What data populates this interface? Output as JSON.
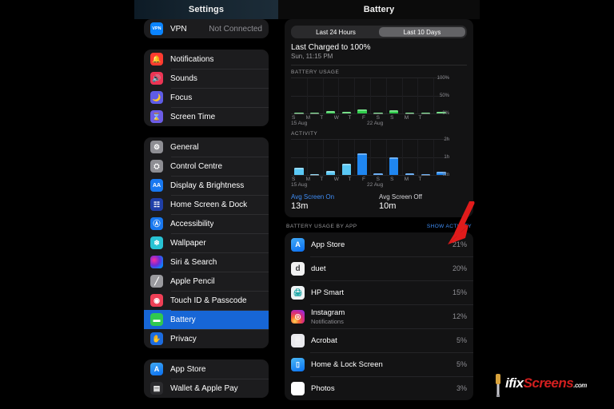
{
  "titles": {
    "sidebar": "Settings",
    "detail": "Battery"
  },
  "sidebar": {
    "groups": [
      {
        "items": [
          {
            "label": "VPN",
            "value": "Not Connected",
            "icon": "vpn-icon",
            "icon_text": "VPN"
          }
        ]
      },
      {
        "items": [
          {
            "label": "Notifications",
            "icon": "notifications-icon",
            "icon_text": "🔔"
          },
          {
            "label": "Sounds",
            "icon": "sounds-icon",
            "icon_text": "🔊"
          },
          {
            "label": "Focus",
            "icon": "focus-icon",
            "icon_text": "🌙"
          },
          {
            "label": "Screen Time",
            "icon": "screen-time-icon",
            "icon_text": "⌛"
          }
        ]
      },
      {
        "items": [
          {
            "label": "General",
            "icon": "general-gear-icon",
            "icon_text": "⚙"
          },
          {
            "label": "Control Centre",
            "icon": "control-centre-icon",
            "icon_text": "⛭"
          },
          {
            "label": "Display & Brightness",
            "icon": "display-brightness-icon",
            "icon_text": "AA"
          },
          {
            "label": "Home Screen & Dock",
            "icon": "home-screen-dock-icon",
            "icon_text": "☷"
          },
          {
            "label": "Accessibility",
            "icon": "accessibility-icon",
            "icon_text": "Ⓐ"
          },
          {
            "label": "Wallpaper",
            "icon": "wallpaper-icon",
            "icon_text": "❄"
          },
          {
            "label": "Siri & Search",
            "icon": "siri-search-icon",
            "icon_text": ""
          },
          {
            "label": "Apple Pencil",
            "icon": "apple-pencil-icon",
            "icon_text": "╱"
          },
          {
            "label": "Touch ID & Passcode",
            "icon": "touch-id-passcode-icon",
            "icon_text": "◉"
          },
          {
            "label": "Battery",
            "icon": "battery-icon",
            "icon_text": "▬",
            "selected": true
          },
          {
            "label": "Privacy",
            "icon": "privacy-hand-icon",
            "icon_text": "✋"
          }
        ]
      },
      {
        "items": [
          {
            "label": "App Store",
            "icon": "app-store-icon",
            "icon_text": "A"
          },
          {
            "label": "Wallet & Apple Pay",
            "icon": "wallet-apple-pay-icon",
            "icon_text": "▤"
          }
        ]
      }
    ]
  },
  "battery": {
    "segmented": {
      "options": [
        "Last 24 Hours",
        "Last 10 Days"
      ],
      "selected": "Last 10 Days"
    },
    "last_charged": "Last Charged to 100%",
    "last_charged_time": "Sun, 11:15 PM",
    "avg_screen_on_label": "Avg Screen On",
    "avg_screen_on_value": "13m",
    "avg_screen_off_label": "Avg Screen Off",
    "avg_screen_off_value": "10m",
    "by_app_title": "BATTERY USAGE BY APP",
    "show_activity": "SHOW ACTIVITY"
  },
  "chart_data": [
    {
      "type": "bar",
      "title": "BATTERY USAGE",
      "categories": [
        "S",
        "M",
        "T",
        "W",
        "T",
        "F",
        "S",
        "S",
        "M",
        "T"
      ],
      "values": [
        3,
        1,
        6,
        5,
        11,
        3,
        10,
        2,
        1,
        4
      ],
      "ylabel": "",
      "ytick_labels": [
        "100%",
        "50%",
        "0%"
      ],
      "ytick_values": [
        100,
        50,
        0
      ],
      "ylim": [
        0,
        100
      ],
      "date_labels": [
        {
          "text": "15 Aug",
          "index": 0
        },
        {
          "text": "22 Aug",
          "index": 7
        }
      ],
      "grid": true,
      "series_color": "#2ecc4a",
      "xlabel": ""
    },
    {
      "type": "bar",
      "title": "ACTIVITY",
      "categories": [
        "S",
        "M",
        "T",
        "W",
        "T",
        "F",
        "S",
        "S",
        "M",
        "T"
      ],
      "values": [
        0.42,
        0.05,
        0.22,
        0.62,
        1.22,
        0.07,
        1.02,
        0.07,
        0.04,
        0.2
      ],
      "bar_shades": [
        "light",
        "light",
        "light",
        "light",
        "dark",
        "dark",
        "dark",
        "dark",
        "dark",
        "dark"
      ],
      "ylabel": "",
      "ytick_labels": [
        "2h",
        "1h",
        "0m"
      ],
      "ytick_values": [
        2,
        1,
        0
      ],
      "ylim": [
        0,
        2
      ],
      "date_labels": [
        {
          "text": "15 Aug",
          "index": 0
        },
        {
          "text": "22 Aug",
          "index": 7
        }
      ],
      "grid": true,
      "series_color_light": "#5ac8f5",
      "series_color_dark": "#1f86f0",
      "xlabel": ""
    }
  ],
  "apps": [
    {
      "name": "App Store",
      "subtitle": "",
      "percent": "21%",
      "icon": "app-store-icon",
      "icon_text": "A",
      "icon_class": "ai-appstore"
    },
    {
      "name": "duet",
      "subtitle": "",
      "percent": "20%",
      "icon": "duet-icon",
      "icon_text": "d",
      "icon_class": "ai-duet"
    },
    {
      "name": "HP Smart",
      "subtitle": "",
      "percent": "15%",
      "icon": "hp-smart-icon",
      "icon_text": "🖨",
      "icon_class": "ai-hp"
    },
    {
      "name": "Instagram",
      "subtitle": "Notifications",
      "percent": "12%",
      "icon": "instagram-icon",
      "icon_text": "◎",
      "icon_class": "ai-ig"
    },
    {
      "name": "Acrobat",
      "subtitle": "",
      "percent": "5%",
      "icon": "acrobat-icon",
      "icon_text": "▒",
      "icon_class": "ai-acrobat"
    },
    {
      "name": "Home & Lock Screen",
      "subtitle": "",
      "percent": "5%",
      "icon": "home-lock-screen-icon",
      "icon_text": "▯",
      "icon_class": "ai-home"
    },
    {
      "name": "Photos",
      "subtitle": "",
      "percent": "3%",
      "icon": "photos-icon",
      "icon_text": "✿",
      "icon_class": "ai-photos"
    }
  ],
  "annotation": {
    "arrow_color": "#e01b1b"
  },
  "watermark": {
    "part1": "ifix",
    "part2": "Screens",
    "part3": ".com"
  }
}
